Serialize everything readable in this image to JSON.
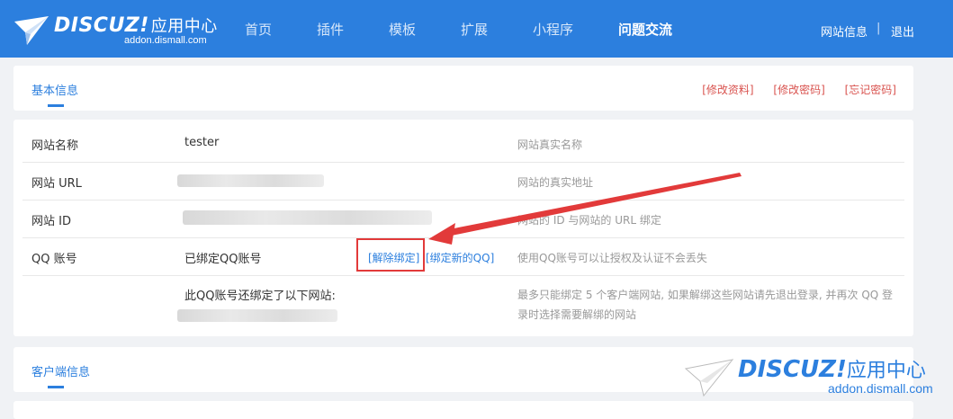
{
  "header": {
    "logo_wordmark": "DISCUZ!",
    "logo_cn": "应用中心",
    "logo_domain": "addon.dismall.com",
    "nav": [
      "首页",
      "插件",
      "模板",
      "扩展",
      "小程序",
      "问题交流"
    ],
    "active_nav": "问题交流",
    "site_info_label": "网站信息",
    "separator": "|",
    "logout_label": "退出"
  },
  "basic": {
    "tab_title": "基本信息",
    "links": [
      "[修改资料]",
      "[修改密码]",
      "[忘记密码]"
    ]
  },
  "rows": {
    "site_name": {
      "label": "网站名称",
      "value": "tester",
      "note": "网站真实名称"
    },
    "site_url": {
      "label": "网站 URL",
      "note": "网站的真实地址"
    },
    "site_id": {
      "label": "网站 ID",
      "note": "网站的 ID 与网站的 URL 绑定"
    },
    "qq": {
      "label": "QQ 账号",
      "value": "已绑定QQ账号",
      "unbind": "[解除绑定]",
      "bind_new": "[绑定新的QQ]",
      "note": "使用QQ账号可以让授权及认证不会丢失"
    },
    "bound_sites": {
      "value": "此QQ账号还绑定了以下网站:",
      "note_line1": "最多只能绑定 5 个客户端网站, 如果解绑这些网站请先退出登录, 并再次 QQ 登",
      "note_line2": "录时选择需要解绑的网站"
    }
  },
  "client": {
    "tab_title": "客户端信息"
  },
  "watermark": {
    "wordmark": "DISCUZ!",
    "cn": "应用中心",
    "domain": "addon.dismall.com"
  },
  "colors": {
    "header_bg": "#2c7fde",
    "accent": "#2c7fde",
    "link_red": "#d9534f",
    "highlight_red": "#e23a3a"
  }
}
